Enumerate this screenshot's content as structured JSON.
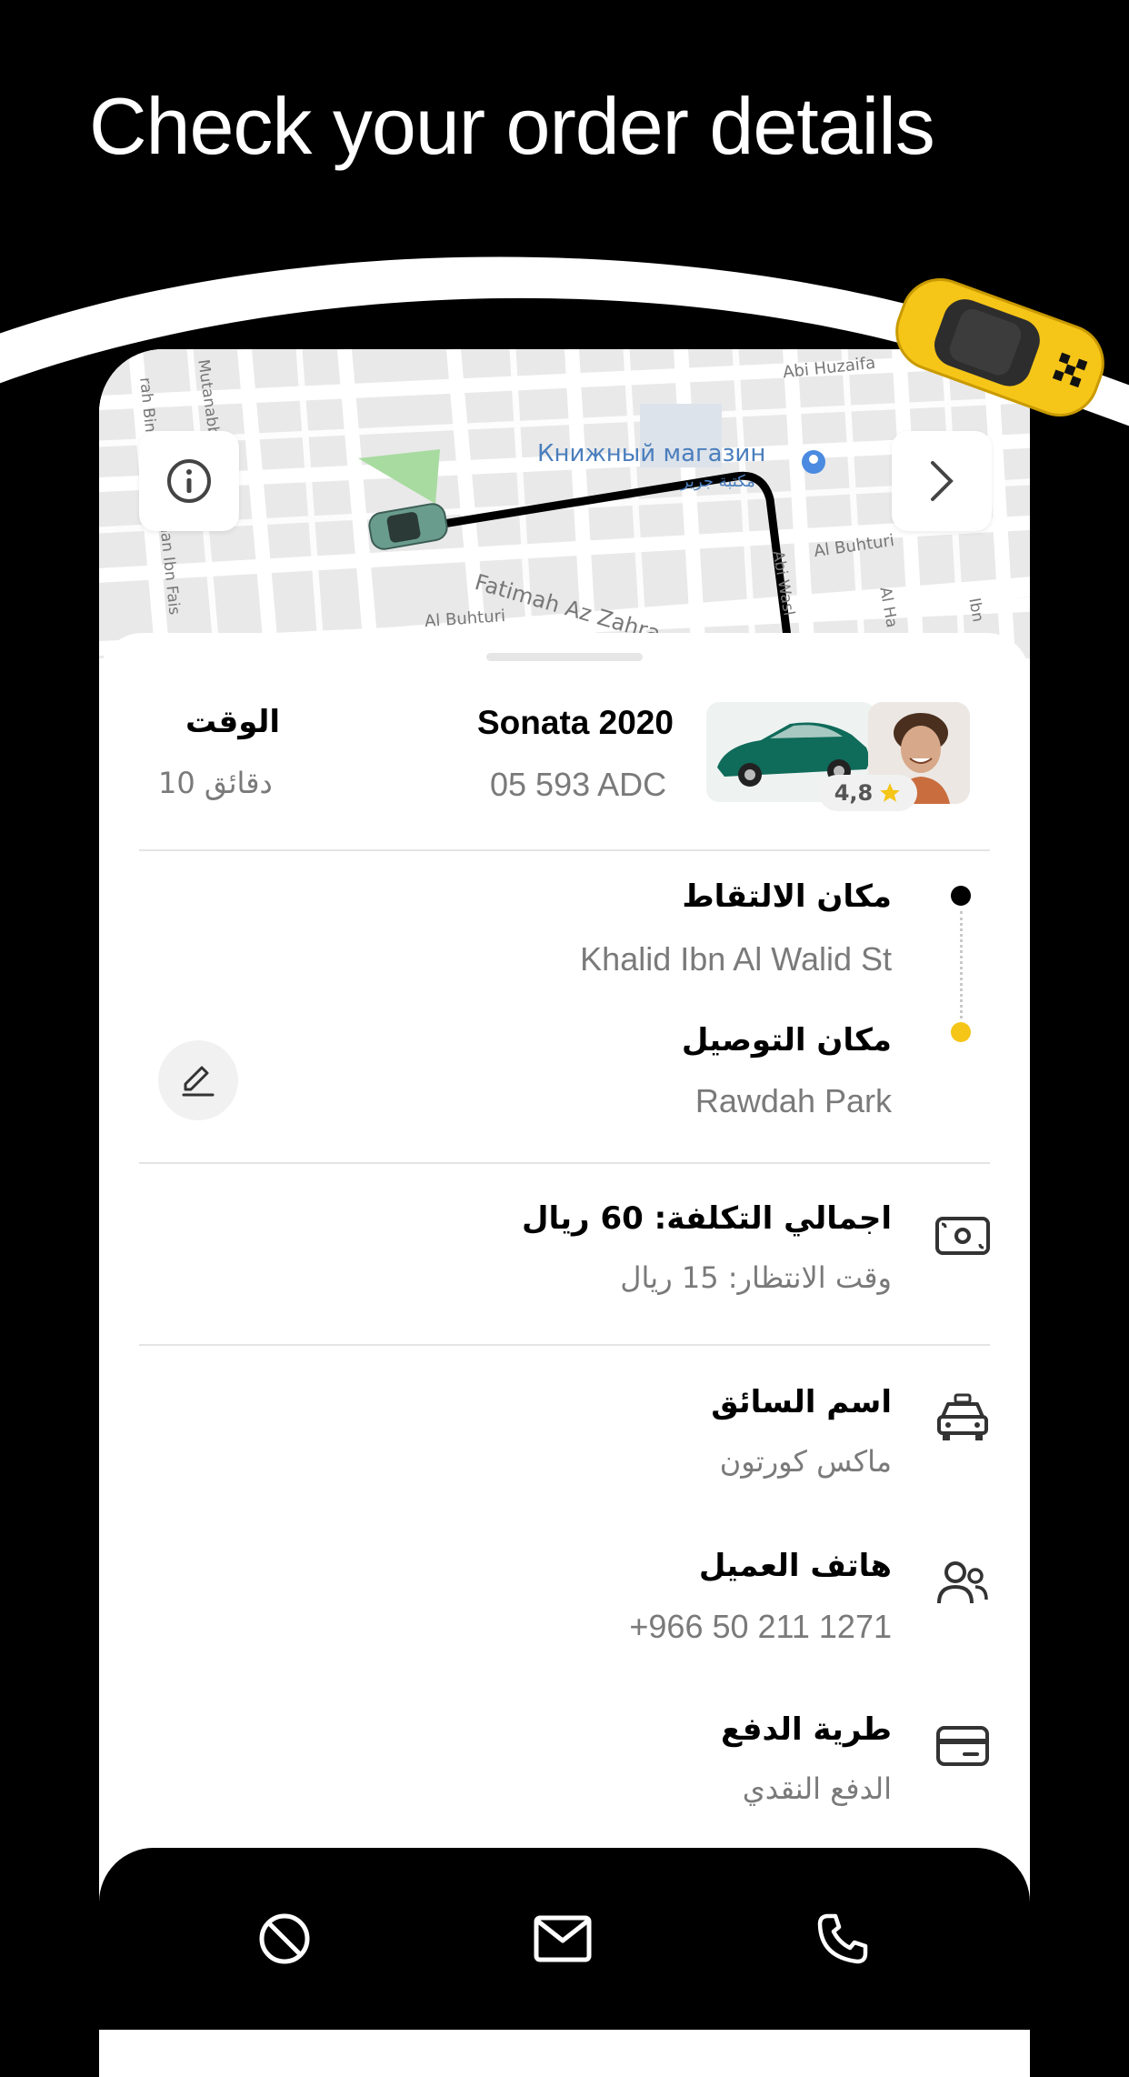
{
  "header": {
    "title": "Check your order details"
  },
  "map": {
    "poi_name": "Книжный магазин",
    "poi_name_ar": "مكتبة جرير",
    "streets": [
      "Fatimah Az Zahra",
      "Al Buhturi",
      "Al Buhturi",
      "Abi Huzaifa",
      "Mutanabbi",
      "Abi Wasl",
      "Al Ha",
      "Ibn",
      "nan Ibn Fais",
      "rah Bint"
    ]
  },
  "trip": {
    "time_label": "الوقت",
    "time_value": "10 دقائق",
    "car_model": "Sonata 2020",
    "plate": "05 593 ADC",
    "rating": "4,8"
  },
  "route": {
    "pickup_label": "مكان الالتقاط",
    "pickup_value": "Khalid Ibn Al Walid St",
    "dropoff_label": "مكان التوصيل",
    "dropoff_value": "Rawdah Park"
  },
  "cost": {
    "total": "اجمالي التكلفة: 60 ريال",
    "waiting": "وقت الانتظار: 15 ريال"
  },
  "driver": {
    "label": "اسم السائق",
    "value": "ماكس كورتون"
  },
  "customer": {
    "label": "هاتف العميل",
    "value": "+966 50 211 1271"
  },
  "payment": {
    "label": "طرية الدفع",
    "value": "الدفع النقدي"
  },
  "colors": {
    "accent": "#F5C518",
    "background": "#000000",
    "text_gray": "#7a7a7a"
  },
  "icons": [
    "info-icon",
    "chevron-right-icon",
    "edit-icon",
    "cash-icon",
    "taxi-icon",
    "users-icon",
    "card-icon",
    "cancel-icon",
    "mail-icon",
    "phone-icon"
  ]
}
